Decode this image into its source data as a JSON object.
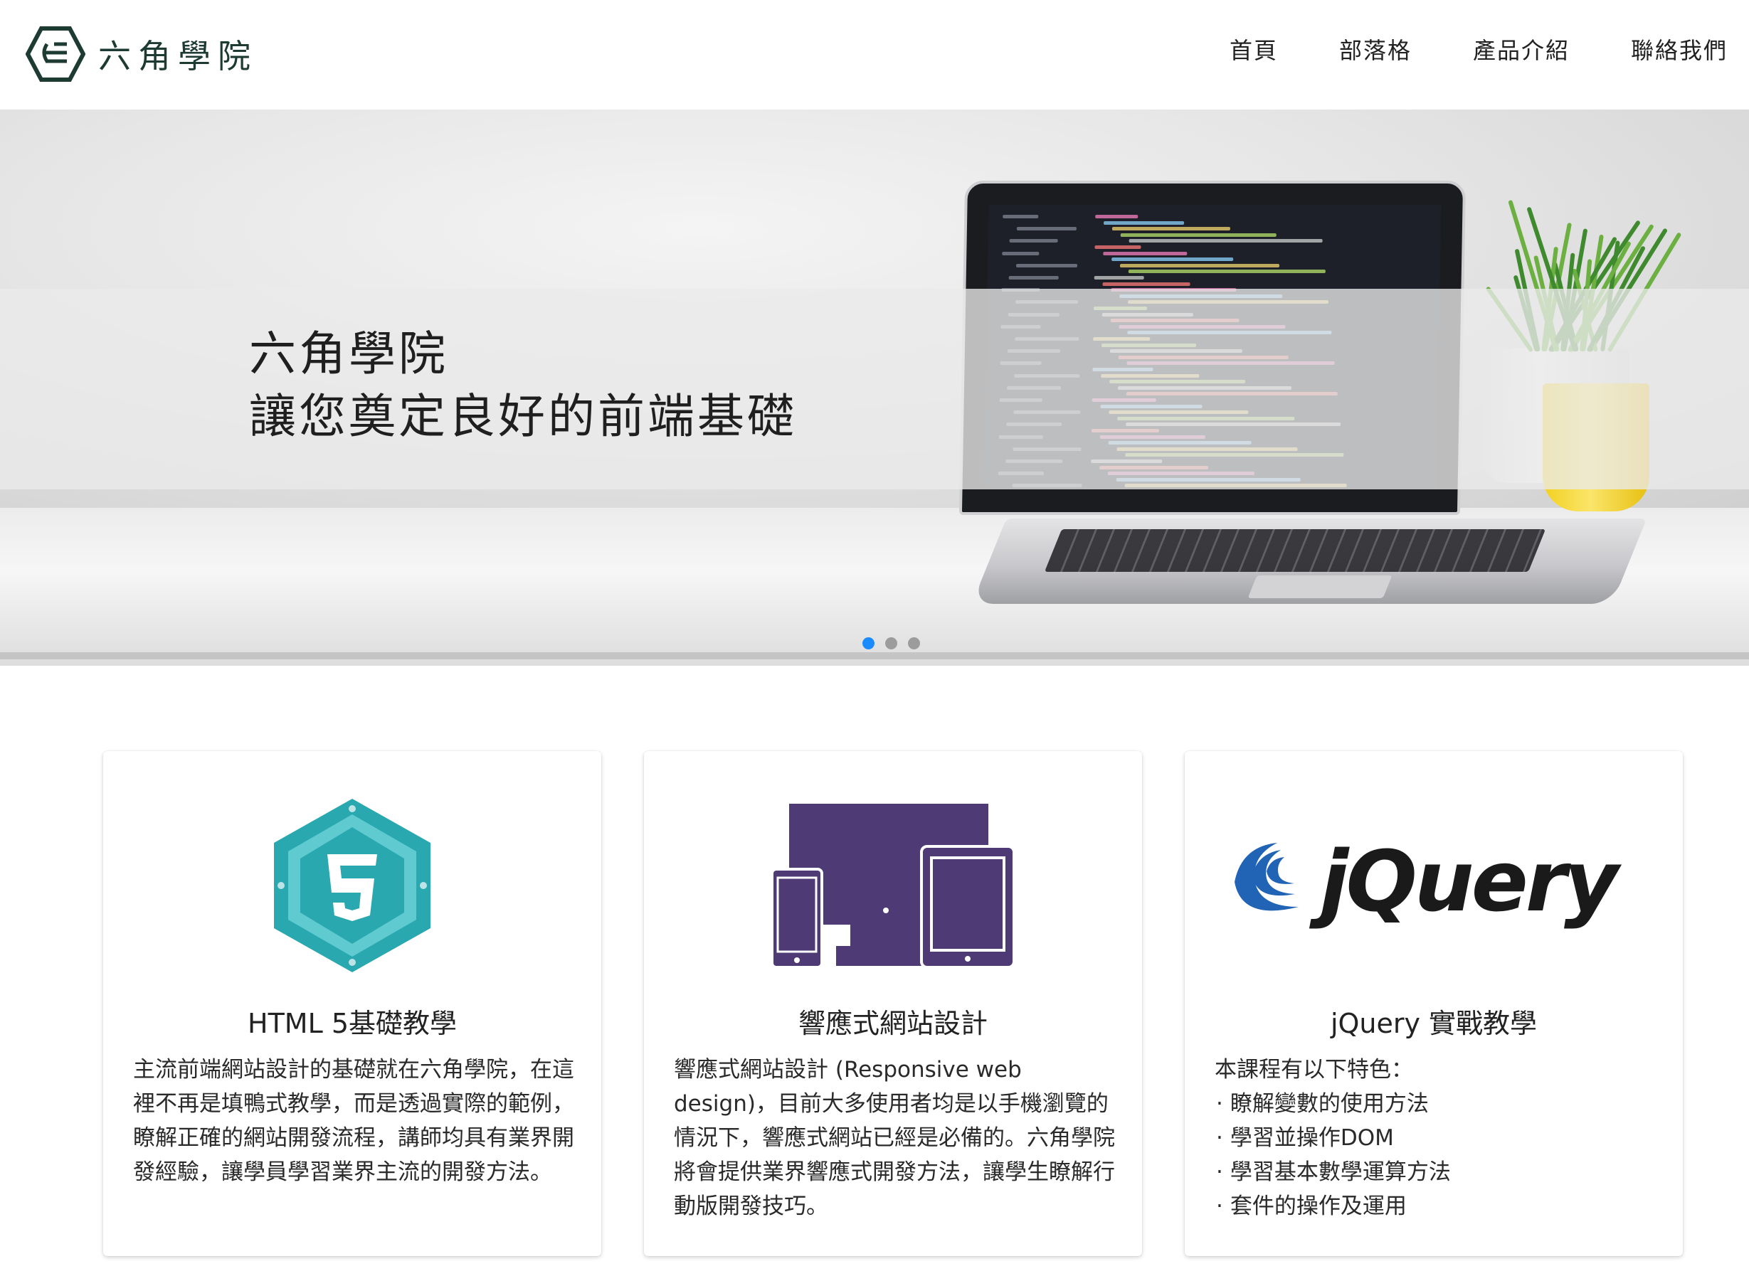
{
  "header": {
    "logo_text": "六角學院",
    "nav": [
      "首頁",
      "部落格",
      "產品介紹",
      "聯絡我們"
    ]
  },
  "hero": {
    "caption_line1": "六角學院",
    "caption_line2": "讓您奠定良好的前端基礎",
    "slides": 3,
    "active_slide": 1,
    "accent_color": "#1a8cff"
  },
  "cards": [
    {
      "icon": "html5-icon",
      "title": "HTML 5基礎教學",
      "body": "主流前端網站設計的基礎就在六角學院，在這裡不再是填鴨式教學，而是透過實際的範例，瞭解正確的網站開發流程，講師均具有業界開發經驗，讓學員學習業界主流的開發方法。"
    },
    {
      "icon": "responsive-devices-icon",
      "title": "響應式網站設計",
      "body": "響應式網站設計 (Responsive web design)，目前大多使用者均是以手機瀏覽的情況下，響應式網站已經是必備的。六角學院將會提供業界響應式開發方法，讓學生瞭解行動版開發技巧。"
    },
    {
      "icon": "jquery-logo-icon",
      "title": "jQuery 實戰教學",
      "intro": "本課程有以下特色：",
      "features": [
        "瞭解變數的使用方法",
        "學習並操作DOM",
        "學習基本數學運算方法",
        "套件的操作及運用"
      ]
    }
  ],
  "colors": {
    "html5_teal": "#2aa8b0",
    "responsive_purple": "#4e3a75",
    "jquery_blue": "#2163b5",
    "jquery_text": "#1a1a1a"
  }
}
